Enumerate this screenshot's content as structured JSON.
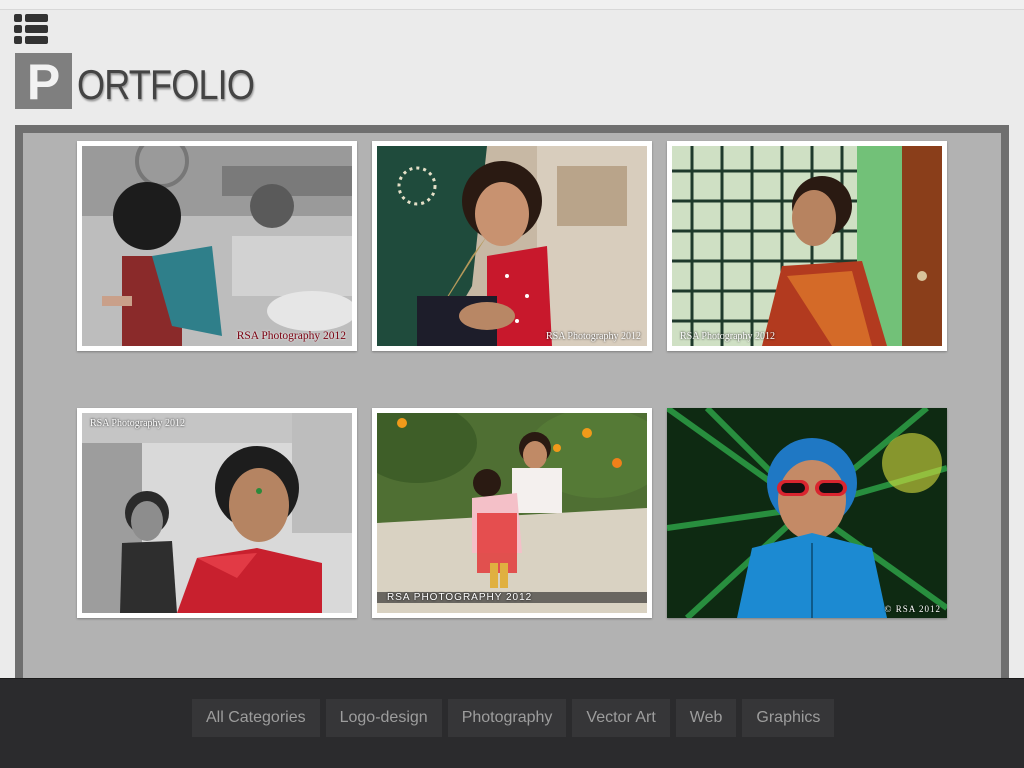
{
  "header": {
    "menu_icon": "list-icon",
    "logo_initial": "P",
    "logo_rest": "ORTFOLIO"
  },
  "gallery": {
    "items": [
      {
        "caption": "RSA Photography 2012"
      },
      {
        "caption": "RSA Photography 2012"
      },
      {
        "caption": "RSA Photography 2012"
      },
      {
        "caption": "RSA Photography 2012"
      },
      {
        "caption": "RSA PHOTOGRAPHY 2012"
      },
      {
        "caption": "© RSA 2012"
      }
    ]
  },
  "footer": {
    "filters": [
      "All Categories",
      "Logo-design",
      "Photography",
      "Vector Art",
      "Web",
      "Graphics"
    ]
  },
  "colors": {
    "page_bg": "#ebebeb",
    "gallery_bg": "#b2b2b2",
    "gallery_border": "#6f6f6f",
    "footer_bg": "#2b2b2d",
    "filter_bg": "#363638",
    "filter_text": "#9d9d9d"
  }
}
